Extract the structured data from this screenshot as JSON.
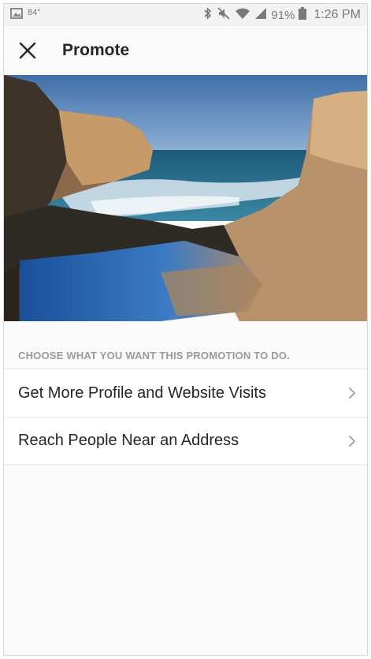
{
  "status_bar": {
    "temperature": "84°",
    "battery_percent": "91%",
    "time": "1:26 PM",
    "icons": [
      "image-icon",
      "bluetooth-icon",
      "mute-icon",
      "wifi-icon",
      "signal-icon",
      "battery-icon"
    ]
  },
  "header": {
    "title": "Promote",
    "close_icon": "close-icon"
  },
  "section": {
    "label": "CHOOSE WHAT YOU WANT THIS PROMOTION TO DO."
  },
  "options": [
    {
      "label": "Get More Profile and Website Visits",
      "icon": "chevron-right-icon"
    },
    {
      "label": "Reach People Near an Address",
      "icon": "chevron-right-icon"
    }
  ],
  "colors": {
    "title_text": "#262626",
    "section_label": "#9a9a9a",
    "divider": "#e6e6e6",
    "chevron": "#9a9a9a"
  }
}
